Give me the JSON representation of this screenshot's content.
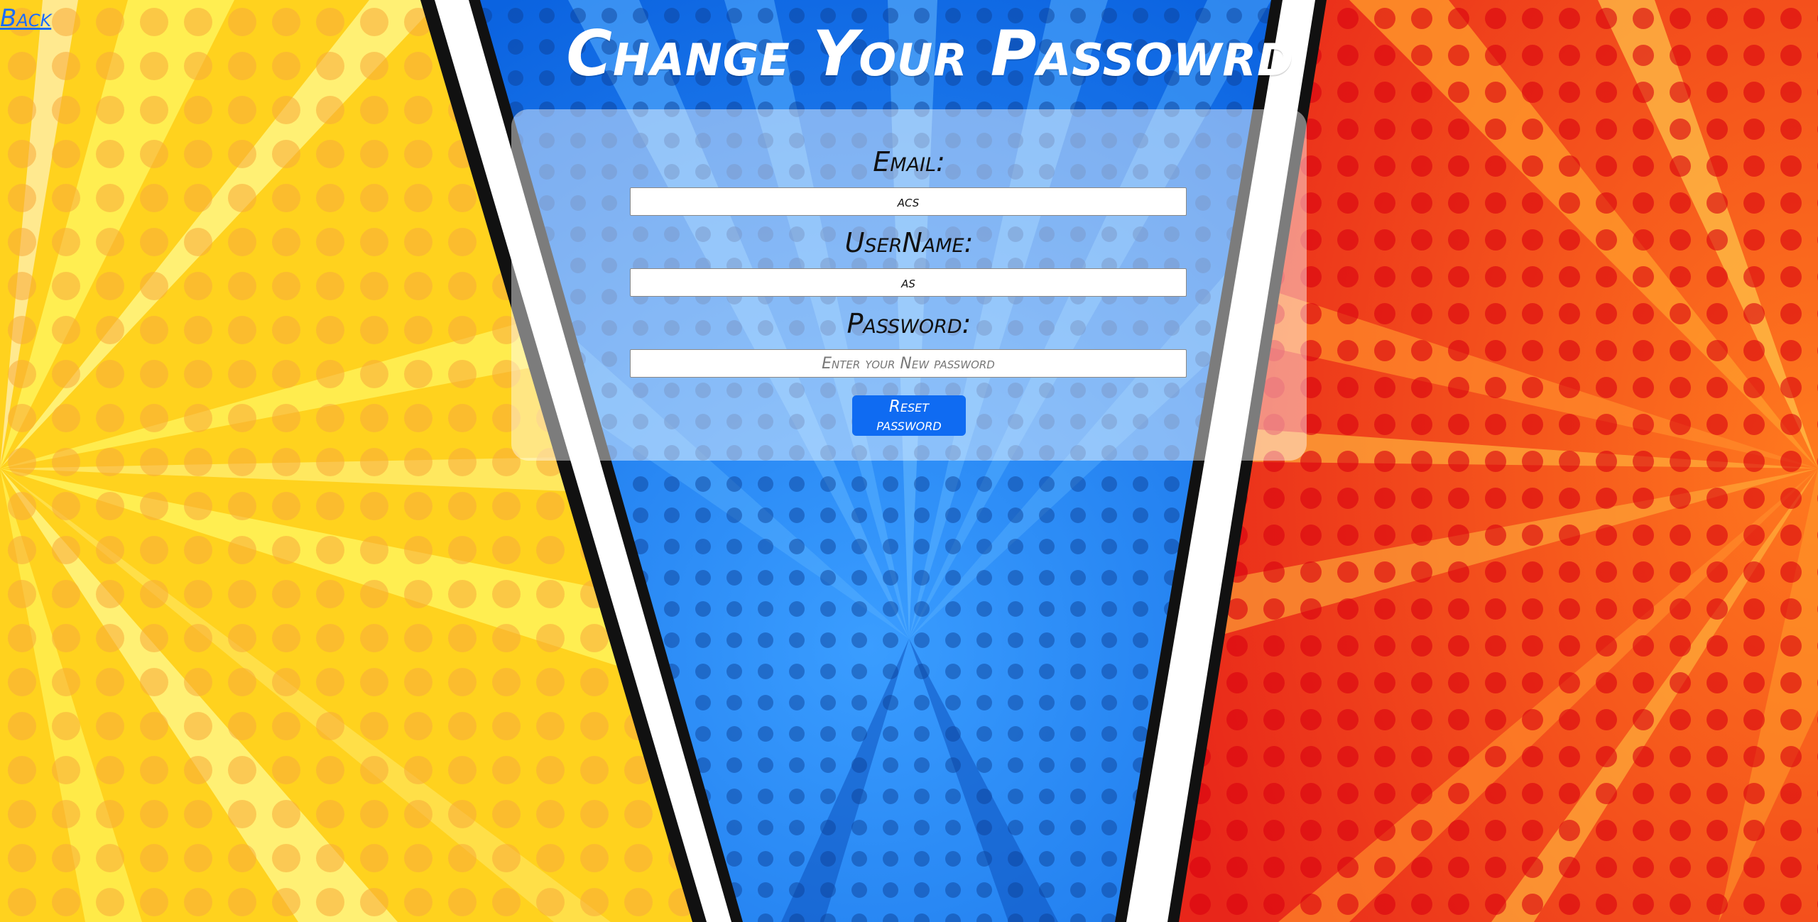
{
  "nav": {
    "back_label": "Back"
  },
  "page": {
    "title": "Change Your Passowrd"
  },
  "form": {
    "email_label": "Email:",
    "email_value": "acs",
    "username_label": "UserName:",
    "username_value": "as",
    "password_label": "Password:",
    "password_value": "",
    "password_placeholder": "Enter your New password",
    "submit_label": "Reset password"
  },
  "colors": {
    "panel_left": "#ffd21e",
    "panel_center": "#1170f0",
    "panel_right": "#f2461a",
    "button": "#0f6bf2",
    "link": "#1a6cff"
  }
}
